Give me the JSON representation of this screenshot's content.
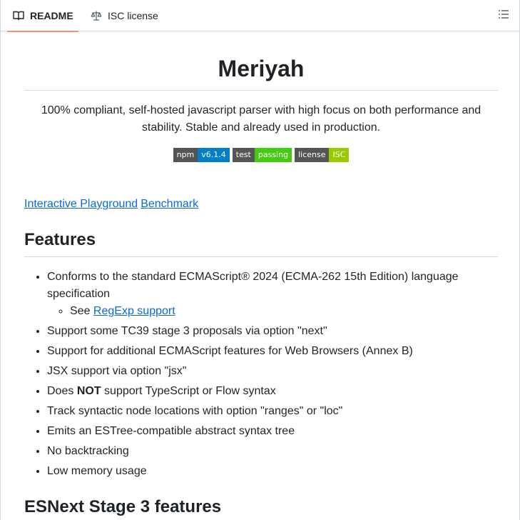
{
  "tabs": {
    "readme": "README",
    "license": "ISC license"
  },
  "readme": {
    "title": "Meriyah",
    "description": "100% compliant, self-hosted javascript parser with high focus on both performance and stability. Stable and already used in production.",
    "badges": [
      {
        "label": "npm",
        "value": "v6.1.4",
        "color": "#007ec6"
      },
      {
        "label": "test",
        "value": "passing",
        "color": "#4c1"
      },
      {
        "label": "license",
        "value": "ISC",
        "color": "#97ca00"
      }
    ],
    "links": [
      "Interactive Playground",
      "Benchmark"
    ],
    "features_heading": "Features",
    "features": {
      "f1": "Conforms to the standard ECMAScript® 2024 (ECMA-262 15th Edition) language specification",
      "f1_sub_prefix": "See",
      "f1_sub_link": "RegExp support",
      "f2": "Support some TC39 stage 3 proposals via option \"next\"",
      "f3": "Support for additional ECMAScript features for Web Browsers (Annex B)",
      "f4": "JSX support via option \"jsx\"",
      "f5_prefix": "Does",
      "f5_bold": "NOT",
      "f5_suffix": "support TypeScript or Flow syntax",
      "f6": "Track syntactic node locations with option \"ranges\" or \"loc\"",
      "f7": "Emits an ESTree-compatible abstract syntax tree",
      "f8": "No backtracking",
      "f9": "Low memory usage"
    },
    "esnext_heading": "ESNext Stage 3 features"
  },
  "colors": {
    "accent_underline": "#fd8c73",
    "link": "#0969da",
    "border": "#d1d9e0"
  }
}
